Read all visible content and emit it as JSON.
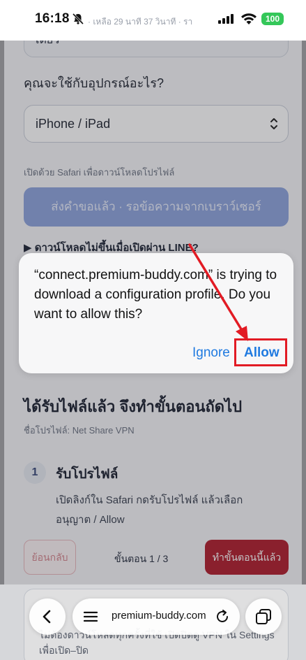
{
  "status_bar": {
    "time": "16:18",
    "ticker": "· เหลือ 29 นาที 37 วินาที · รา",
    "battery": "100"
  },
  "form": {
    "previous_field_text": "เดียว",
    "device_question": "คุณจะใช้กับอุปกรณ์อะไร?",
    "device_select_value": "iPhone / iPad",
    "safari_hint": "เปิดด้วย Safari เพื่อดาวน์โหลดโปรไฟล์",
    "request_button": "ส่งคำขอแล้ว · รอข้อความจากเบราว์เซอร์",
    "line_disclosure": "▶ ดาวน์โหลดไม่ขึ้นเมื่อเปิดผ่าน LINE?"
  },
  "steps": {
    "title": "ได้รับไฟล์แล้ว จึงทำขั้นตอนถัดไป",
    "profile_name": "ชื่อโปรไฟล์: Net Share VPN",
    "step_number": "1",
    "step_title": "รับโปรไฟล์",
    "step_description": "เปิดลิงก์ใน Safari กดรับโปรไฟล์ แล้วเลือก อนุญาต / Allow",
    "back_label": "ย้อนกลับ",
    "counter": "ขั้นตอน 1 / 3",
    "next_label": "ทำขั้นตอนนี้แล้ว"
  },
  "bottom_card": {
    "line1": "ไม่ต้องดาวน์โหลดทุกครั้งที่ใช้ เปิดปิดดู VPN ใน Settings",
    "line2": "เพื่อเปิด–ปิด"
  },
  "alert": {
    "message": "“connect.premium-buddy.com” is trying to download a configuration profile. Do you want to allow this?",
    "ignore_label": "Ignore",
    "allow_label": "Allow"
  },
  "browser": {
    "url": "premium-buddy.com"
  },
  "colors": {
    "accent_blue": "#1f7ae0",
    "annotation_red": "#e21b24",
    "next_button": "#b01e2d",
    "request_button": "#8ea4dd",
    "battery_green": "#34c759"
  }
}
